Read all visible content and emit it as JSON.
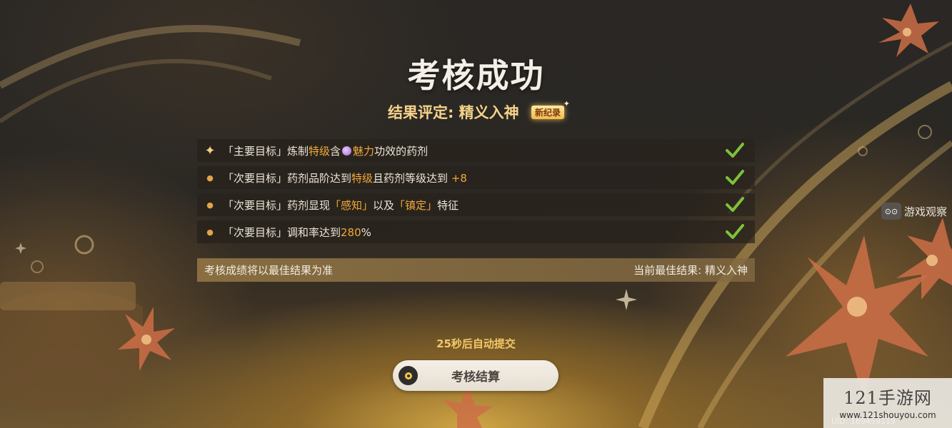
{
  "title": "考核成功",
  "rating": {
    "label": "结果评定: 精义入神",
    "badge": "新纪录"
  },
  "goals": [
    {
      "marker": "star",
      "parts": [
        "「主要目标」炼制",
        "特级",
        "含",
        "魅力",
        "功效的药剂"
      ],
      "attr_icon": "charm-icon",
      "status": "done"
    },
    {
      "marker": "dot",
      "parts": [
        "「次要目标」药剂品阶达到",
        "特级",
        "且药剂等级达到 ",
        "+8"
      ],
      "status": "done"
    },
    {
      "marker": "dot",
      "parts": [
        "「次要目标」药剂显现",
        "「感知」",
        "以及",
        "「镇定」",
        "特征"
      ],
      "status": "done"
    },
    {
      "marker": "dot",
      "parts": [
        "「次要目标」调和率达到",
        "280",
        "%"
      ],
      "status": "done"
    }
  ],
  "footer": {
    "note": "考核成绩将以最佳结果为准",
    "best": "当前最佳结果: 精义入神"
  },
  "countdown": "25秒后自动提交",
  "settle_button": "考核结算",
  "watermark": {
    "tag": "游戏观察",
    "site_name": "121手游网",
    "site_url": "www.121shouyou.com",
    "uid": "UID: 169459119"
  },
  "colors": {
    "highlight": "#f0a93a",
    "check": "#7ec23a",
    "title": "#f3efe6"
  }
}
